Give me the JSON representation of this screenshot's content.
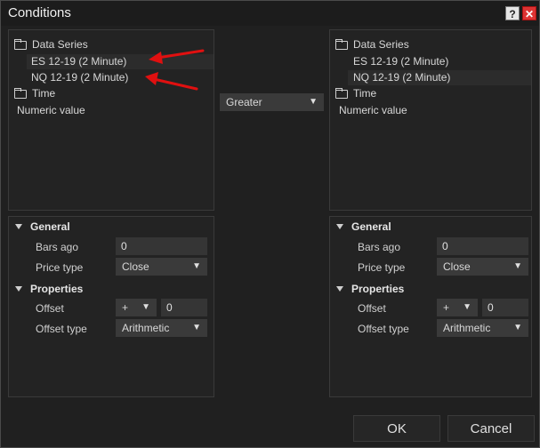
{
  "window": {
    "title": "Conditions",
    "help_label": "?",
    "close_label": "✕"
  },
  "left": {
    "tree": {
      "group_label": "Data Series",
      "items": [
        "ES 12-19 (2 Minute)",
        "NQ 12-19 (2 Minute)"
      ],
      "time_label": "Time",
      "numeric_label": "Numeric value"
    },
    "props": {
      "general_label": "General",
      "bars_ago_label": "Bars ago",
      "bars_ago_value": "0",
      "price_type_label": "Price type",
      "price_type_value": "Close",
      "properties_label": "Properties",
      "offset_label": "Offset",
      "offset_sign": "+",
      "offset_value": "0",
      "offset_type_label": "Offset type",
      "offset_type_value": "Arithmetic"
    }
  },
  "operator": {
    "value": "Greater"
  },
  "right": {
    "tree": {
      "group_label": "Data Series",
      "items": [
        "ES 12-19 (2 Minute)",
        "NQ 12-19 (2 Minute)"
      ],
      "time_label": "Time",
      "numeric_label": "Numeric value"
    },
    "props": {
      "general_label": "General",
      "bars_ago_label": "Bars ago",
      "bars_ago_value": "0",
      "price_type_label": "Price type",
      "price_type_value": "Close",
      "properties_label": "Properties",
      "offset_label": "Offset",
      "offset_sign": "+",
      "offset_value": "0",
      "offset_type_label": "Offset type",
      "offset_type_value": "Arithmetic"
    }
  },
  "buttons": {
    "ok": "OK",
    "cancel": "Cancel"
  },
  "colors": {
    "annotation_arrow": "#e01010",
    "close_button": "#d33333"
  }
}
